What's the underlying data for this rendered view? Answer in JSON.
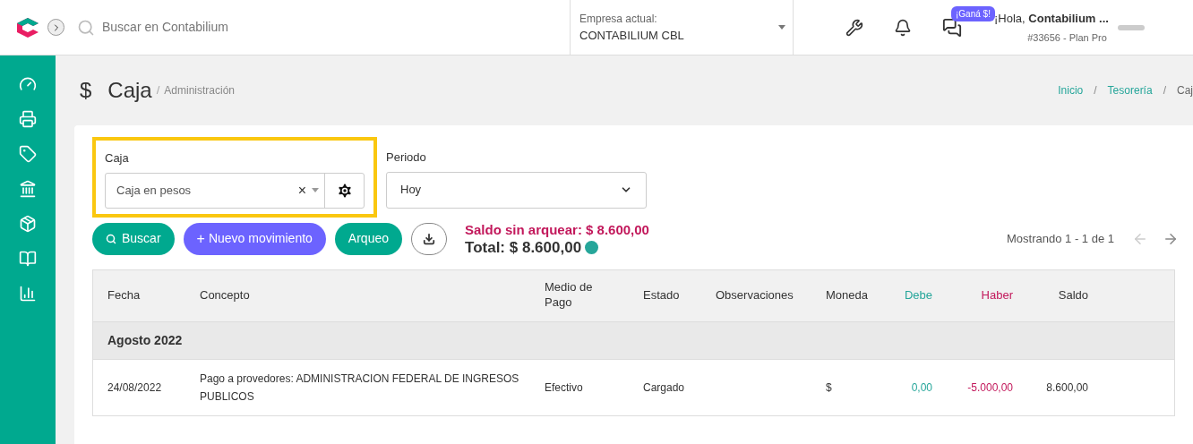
{
  "topbar": {
    "search": {
      "placeholder": "Buscar en Contabilium"
    },
    "company": {
      "label": "Empresa actual:",
      "value": "CONTABILIUM CBL"
    },
    "promo_badge": "¡Ganá $!",
    "user": {
      "greeting": "¡Hola, ",
      "name": "Contabilium ...",
      "plan": "#33656 - Plan Pro"
    }
  },
  "page": {
    "icon": "$",
    "title": "Caja",
    "separator": "/",
    "subtitle": "Administración",
    "breadcrumb": {
      "separator": "/",
      "items": [
        "Inicio",
        "Tesorería",
        "Caj"
      ]
    }
  },
  "filters": {
    "caja": {
      "label": "Caja",
      "value": "Caja en pesos",
      "clear": "×",
      "highlighted": true
    },
    "periodo": {
      "label": "Periodo",
      "value": "Hoy"
    }
  },
  "actions": {
    "search": "Buscar",
    "new": "Nuevo movimiento",
    "new_icon": "+",
    "arqueo": "Arqueo"
  },
  "summary": {
    "unreconciled": "Saldo sin arquear: $ 8.600,00",
    "total": "Total: $ 8.600,00",
    "status": {
      "color": "#26a69a"
    }
  },
  "pagination": {
    "text": "Mostrando 1 - 1 de 1",
    "prev_disabled": true,
    "next_disabled": false
  },
  "table": {
    "columns": [
      {
        "label": "Fecha",
        "kind": "text"
      },
      {
        "label": "Concepto",
        "kind": "text"
      },
      {
        "label": "Medio de Pago",
        "kind": "text"
      },
      {
        "label": "Estado",
        "kind": "text"
      },
      {
        "label": "Observaciones",
        "kind": "text"
      },
      {
        "label": "Moneda",
        "kind": "text"
      },
      {
        "label": "Debe",
        "kind": "debit"
      },
      {
        "label": "Haber",
        "kind": "credit"
      },
      {
        "label": "Saldo",
        "kind": "amount"
      }
    ],
    "groups": [
      {
        "title": "Agosto 2022",
        "rows": [
          [
            "24/08/2022",
            "Pago a provedores: ADMINISTRACION FEDERAL DE INGRESOS PUBLICOS",
            "Efectivo",
            "Cargado",
            "",
            "$",
            "0,00",
            "-5.000,00",
            "8.600,00"
          ]
        ]
      }
    ]
  }
}
